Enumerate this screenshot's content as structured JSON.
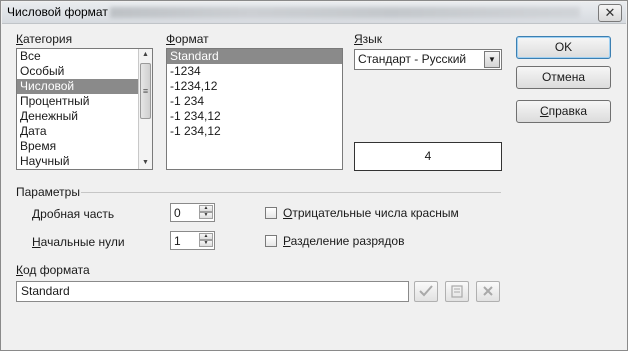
{
  "window": {
    "title": "Числовой формат",
    "close_glyph": "✕"
  },
  "category": {
    "label_prefix": "",
    "label_mnemonic": "К",
    "label_rest": "атегория",
    "items": [
      "Все",
      "Особый",
      "Числовой",
      "Процентный",
      "Денежный",
      "Дата",
      "Время",
      "Научный"
    ],
    "selected_index": 2
  },
  "format": {
    "label_mnemonic": "Ф",
    "label_rest": "ормат",
    "items": [
      "Standard",
      "-1234",
      "-1234,12",
      "-1 234",
      "-1 234,12",
      "-1 234,12"
    ],
    "selected_index": 0
  },
  "language": {
    "label_mnemonic": "Я",
    "label_rest": "зык",
    "value": "Стандарт - Русский"
  },
  "preview": {
    "value": "4"
  },
  "buttons": {
    "ok": "OK",
    "cancel": "Отмена",
    "help_mnemonic": "С",
    "help_rest": "правка"
  },
  "options": {
    "section_label": "Параметры",
    "decimals": {
      "label_mnemonic": "Д",
      "label_rest": "робная часть",
      "value": "0"
    },
    "leading_zeros": {
      "label_mnemonic": "Н",
      "label_rest": "ачальные нули",
      "value": "1"
    },
    "negative_red": {
      "label_mnemonic": "О",
      "label_rest": "трицательные числа красным",
      "checked": false
    },
    "thousands_sep": {
      "label_mnemonic": "Р",
      "label_rest": "азделение разрядов",
      "checked": false
    }
  },
  "format_code": {
    "label_mnemonic": "К",
    "label_rest": "од формата",
    "value": "Standard"
  },
  "icons": {
    "accept": "checkmark-icon",
    "comment": "edit-comment-icon",
    "delete": "delete-x-icon"
  }
}
